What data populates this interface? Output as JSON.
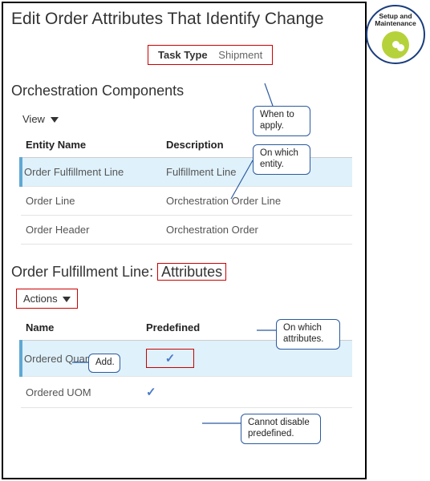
{
  "page_title": "Edit Order Attributes That Identify Change",
  "task_type": {
    "label": "Task Type",
    "value": "Shipment"
  },
  "orch_section": {
    "heading": "Orchestration Components",
    "view_label": "View",
    "cols": {
      "entity": "Entity Name",
      "desc": "Description"
    },
    "rows": [
      {
        "entity": "Order Fulfillment Line",
        "desc": "Fulfillment Line",
        "selected": true
      },
      {
        "entity": "Order Line",
        "desc": "Orchestration Order Line"
      },
      {
        "entity": "Order Header",
        "desc": "Orchestration Order"
      }
    ]
  },
  "attr_section": {
    "prefix": "Order Fulfillment Line:",
    "boxed": "Attributes",
    "actions_label": "Actions",
    "cols": {
      "name": "Name",
      "pred": "Predefined"
    },
    "rows": [
      {
        "name": "Ordered Quantity",
        "pred": true,
        "selected": true,
        "boxed": true
      },
      {
        "name": "Ordered UOM",
        "pred": true
      }
    ]
  },
  "callouts": {
    "when": "When to apply.",
    "entity": "On which entity.",
    "attrs": "On which attributes.",
    "add": "Add.",
    "pred": "Cannot disable predefined."
  },
  "badge": {
    "line1": "Setup and",
    "line2": "Maintenance"
  }
}
